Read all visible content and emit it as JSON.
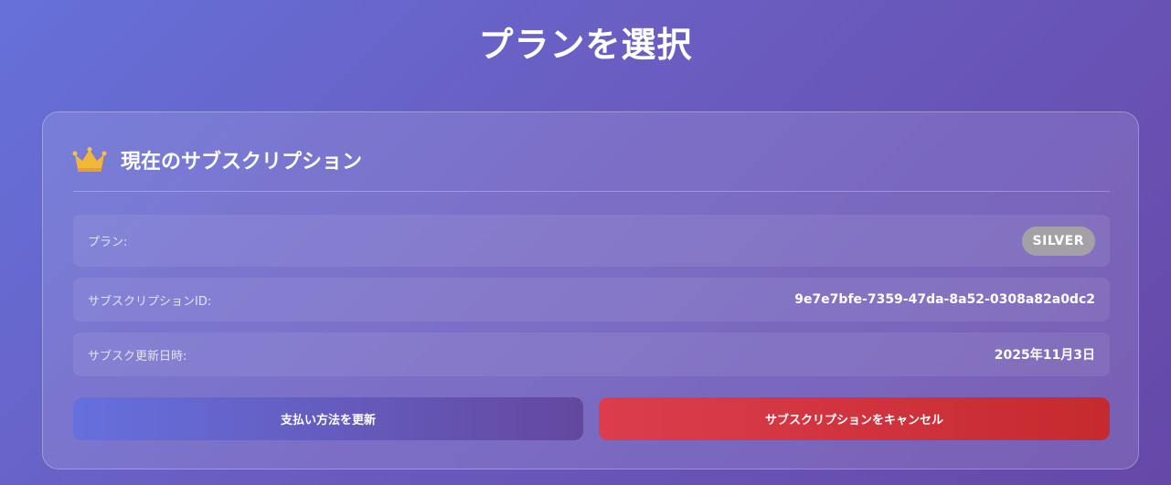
{
  "page": {
    "title": "プランを選択"
  },
  "subscription_card": {
    "title": "現在のサブスクリプション",
    "icon": "crown-icon",
    "rows": [
      {
        "label": "プラン:",
        "value": "SILVER"
      },
      {
        "label": "サブスクリプションID:",
        "value": "9e7e7bfe-7359-47da-8a52-0308a82a0dc2"
      },
      {
        "label": "サブスク更新日時:",
        "value": "2025年11月3日"
      }
    ],
    "buttons": {
      "update_payment": "支払い方法を更新",
      "cancel_subscription": "サブスクリプションをキャンセル"
    }
  },
  "colors": {
    "background_start": "#6571d9",
    "background_end": "#6648a8",
    "badge": "#a3a1a6",
    "update_button": "#6570de",
    "cancel_button": "#dc3d4d",
    "crown": "#f2b73a"
  }
}
